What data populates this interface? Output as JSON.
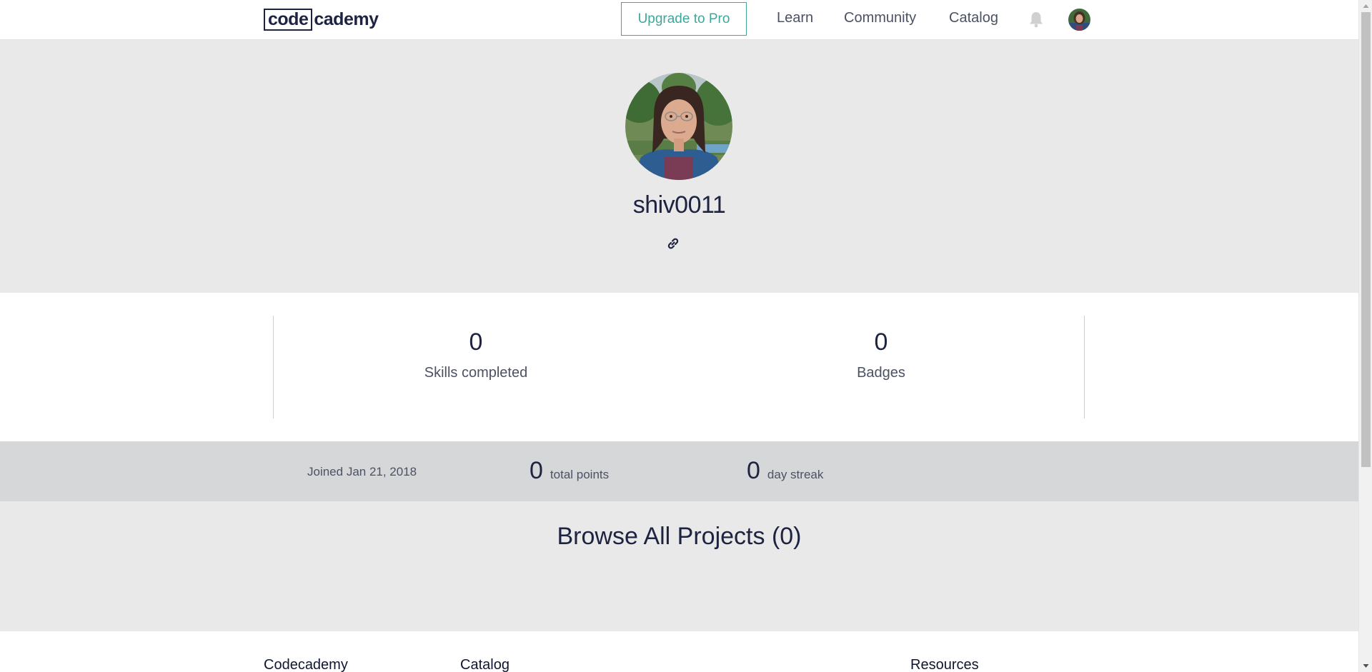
{
  "nav": {
    "logo_boxed": "code",
    "logo_rest": "cademy",
    "upgrade_label": "Upgrade to Pro",
    "learn": "Learn",
    "community": "Community",
    "catalog": "Catalog"
  },
  "profile": {
    "username": "shiv0011"
  },
  "stats": {
    "skills_count": "0",
    "skills_label": "Skills completed",
    "badges_count": "0",
    "badges_label": "Badges"
  },
  "meta": {
    "joined": "Joined Jan 21, 2018",
    "points_value": "0",
    "points_label": "total points",
    "streak_value": "0",
    "streak_label": "day streak"
  },
  "projects": {
    "title": "Browse All Projects (0)"
  },
  "footer": {
    "col1": "Codecademy",
    "col2": "Catalog",
    "col3": "Resources"
  },
  "colors": {
    "brand_navy": "#1d2340",
    "pro_teal": "#3fa79a",
    "hero_bg": "#e9e9e9",
    "meta_bg": "#d6d7d9"
  },
  "icons": {
    "bell": "bell-icon",
    "link": "link-icon"
  }
}
